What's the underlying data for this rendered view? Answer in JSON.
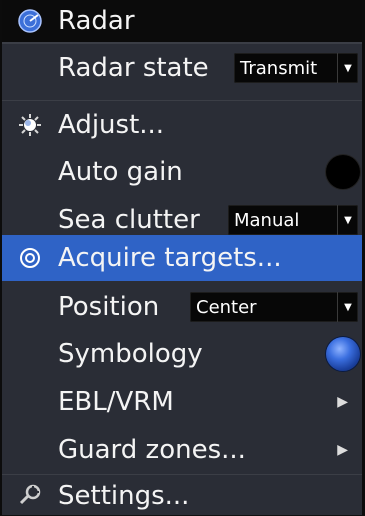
{
  "menu": {
    "title": "Radar",
    "radar_state": {
      "label": "Radar state",
      "value": "Transmit"
    },
    "adjust": "Adjust...",
    "auto_gain": {
      "label": "Auto gain",
      "state": "off"
    },
    "sea_clutter": {
      "label": "Sea clutter",
      "value": "Manual"
    },
    "acquire_targets": "Acquire targets...",
    "position": {
      "label": "Position",
      "value": "Center"
    },
    "symbology": {
      "label": "Symbology",
      "state": "on"
    },
    "ebl_vrm": "EBL/VRM",
    "guard_zones": "Guard zones...",
    "settings": "Settings..."
  },
  "colors": {
    "highlight": "#2f63c6",
    "background": "#2a2d36",
    "title_bar": "#0b0b0b"
  }
}
